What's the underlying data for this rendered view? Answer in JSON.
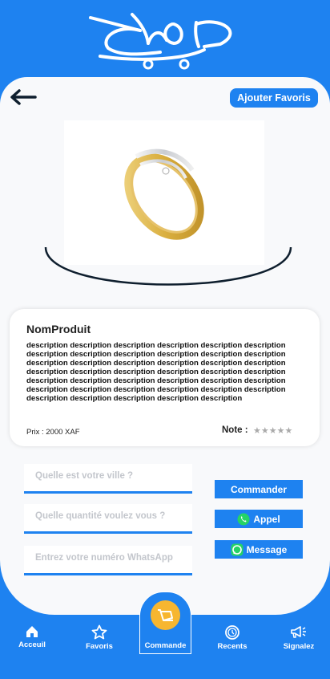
{
  "app": {
    "logo_text": "SHOP"
  },
  "top": {
    "favorites_button": "Ajouter Favoris"
  },
  "product": {
    "name": "NomProduit",
    "description": "description description description description description description description description description description description description description description description description description description description description description description description description description description description description description description description description description description description description description description description description description",
    "price": "Prix : 2000 XAF",
    "rating_label": "Note :",
    "rating_stars": "★★★★★",
    "rating_value": 0
  },
  "form": {
    "city_placeholder": "Quelle est votre ville ?",
    "quantity_placeholder": "Quelle quantité voulez vous ?",
    "whatsapp_placeholder": "Entrez votre numéro WhatsApp"
  },
  "actions": {
    "order": "Commander",
    "call": "Appel",
    "message": "Message"
  },
  "nav": {
    "home": "Acceuil",
    "favorites": "Favoris",
    "order": "Commande",
    "recent": "Recents",
    "report": "Signalez"
  },
  "colors": {
    "primary": "#1E82F0",
    "accent": "#F7B630",
    "whatsapp": "#25D366"
  }
}
